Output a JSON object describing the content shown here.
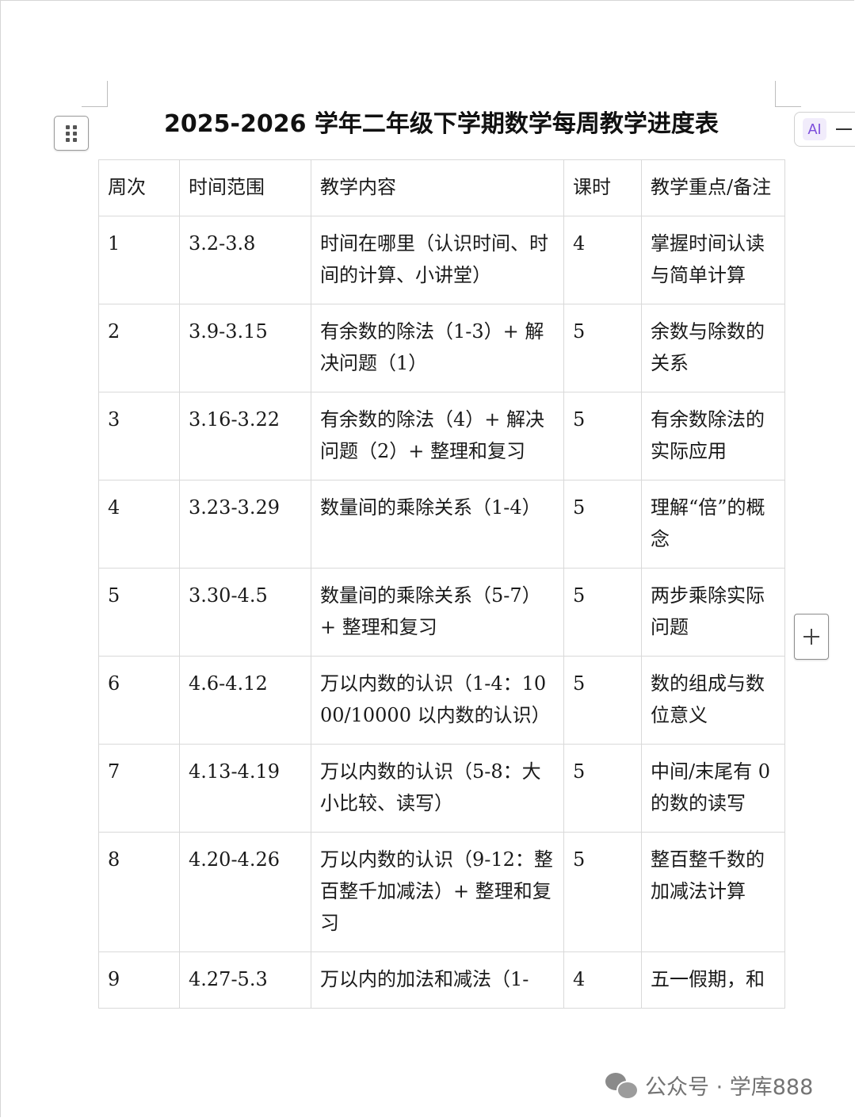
{
  "document": {
    "title": "2025-2026 学年二年级下学期数学每周教学进度表"
  },
  "toolbar": {
    "ai_label": "AI"
  },
  "table": {
    "headers": [
      "周次",
      "时间范围",
      "教学内容",
      "课时",
      "教学重点/备注"
    ],
    "rows": [
      [
        "1",
        "3.2-3.8",
        "时间在哪里（认识时间、时间的计算、小讲堂）",
        "4",
        "掌握时间认读与简单计算"
      ],
      [
        "2",
        "3.9-3.15",
        "有余数的除法（1-3）+ 解决问题（1）",
        "5",
        "余数与除数的关系"
      ],
      [
        "3",
        "3.16-3.22",
        "有余数的除法（4）+ 解决问题（2）+ 整理和复习",
        "5",
        "有余数除法的实际应用"
      ],
      [
        "4",
        "3.23-3.29",
        "数量间的乘除关系（1-4）",
        "5",
        "理解“倍”的概念"
      ],
      [
        "5",
        "3.30-4.5",
        "数量间的乘除关系（5-7）+ 整理和复习",
        "5",
        "两步乘除实际问题"
      ],
      [
        "6",
        "4.6-4.12",
        "万以内数的认识（1-4：1000/10000 以内数的认识）",
        "5",
        "数的组成与数位意义"
      ],
      [
        "7",
        "4.13-4.19",
        "万以内数的认识（5-8：大小比较、读写）",
        "5",
        "中间/末尾有 0 的数的读写"
      ],
      [
        "8",
        "4.20-4.26",
        "万以内数的认识（9-12：整百整千加减法）+ 整理和复习",
        "5",
        "整百整千数的加减法计算"
      ],
      [
        "9",
        "4.27-5.3",
        "万以内的加法和减法（1-",
        "4",
        "五一假期，和"
      ]
    ]
  },
  "watermark": {
    "text": "公众号 · 学库888"
  }
}
